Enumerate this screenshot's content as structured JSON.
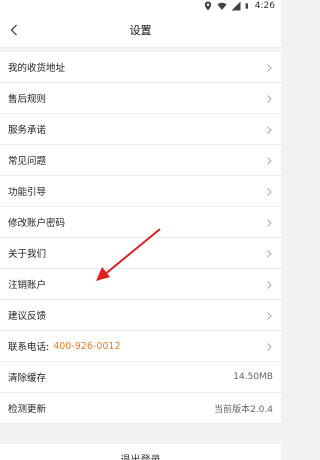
{
  "status_bar": {
    "time": "4:26"
  },
  "header": {
    "title": "设置"
  },
  "menu": {
    "items": [
      {
        "label": "我的收货地址"
      },
      {
        "label": "售后规则"
      },
      {
        "label": "服务承诺"
      },
      {
        "label": "常见问题"
      },
      {
        "label": "功能引导"
      },
      {
        "label": "修改账户密码"
      },
      {
        "label": "关于我们"
      },
      {
        "label": "注销账户"
      },
      {
        "label": "建议反馈"
      }
    ],
    "phone": {
      "label": "联系电话:",
      "number": "400-926-0012"
    },
    "cache": {
      "label": "清除缓存",
      "value": "14.50MB"
    },
    "update": {
      "label": "检测更新",
      "value": "当前版本2.0.4"
    }
  },
  "footer": {
    "logout_label": "退出登录"
  },
  "colors": {
    "accent": "#f07c22",
    "arrow": "#e02020"
  }
}
